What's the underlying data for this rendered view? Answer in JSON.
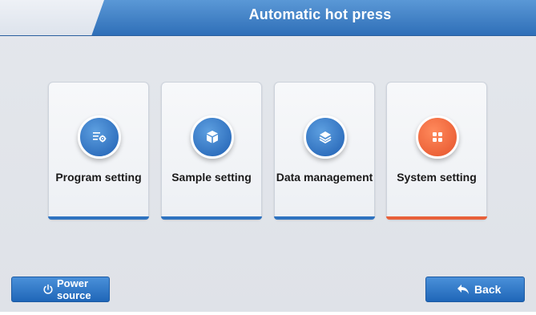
{
  "header": {
    "title": "Automatic hot press"
  },
  "cards": [
    {
      "label": "Program setting",
      "icon": "list-gear-icon",
      "accent": "#2f73c0"
    },
    {
      "label": "Sample setting",
      "icon": "cube-icon",
      "accent": "#2f73c0"
    },
    {
      "label": "Data management",
      "icon": "layers-icon",
      "accent": "#2f73c0"
    },
    {
      "label": "System setting",
      "icon": "grid-icon",
      "accent": "#e8603a"
    }
  ],
  "footer": {
    "power_label_line1": "Power",
    "power_label_line2": "source",
    "back_label": "Back"
  }
}
